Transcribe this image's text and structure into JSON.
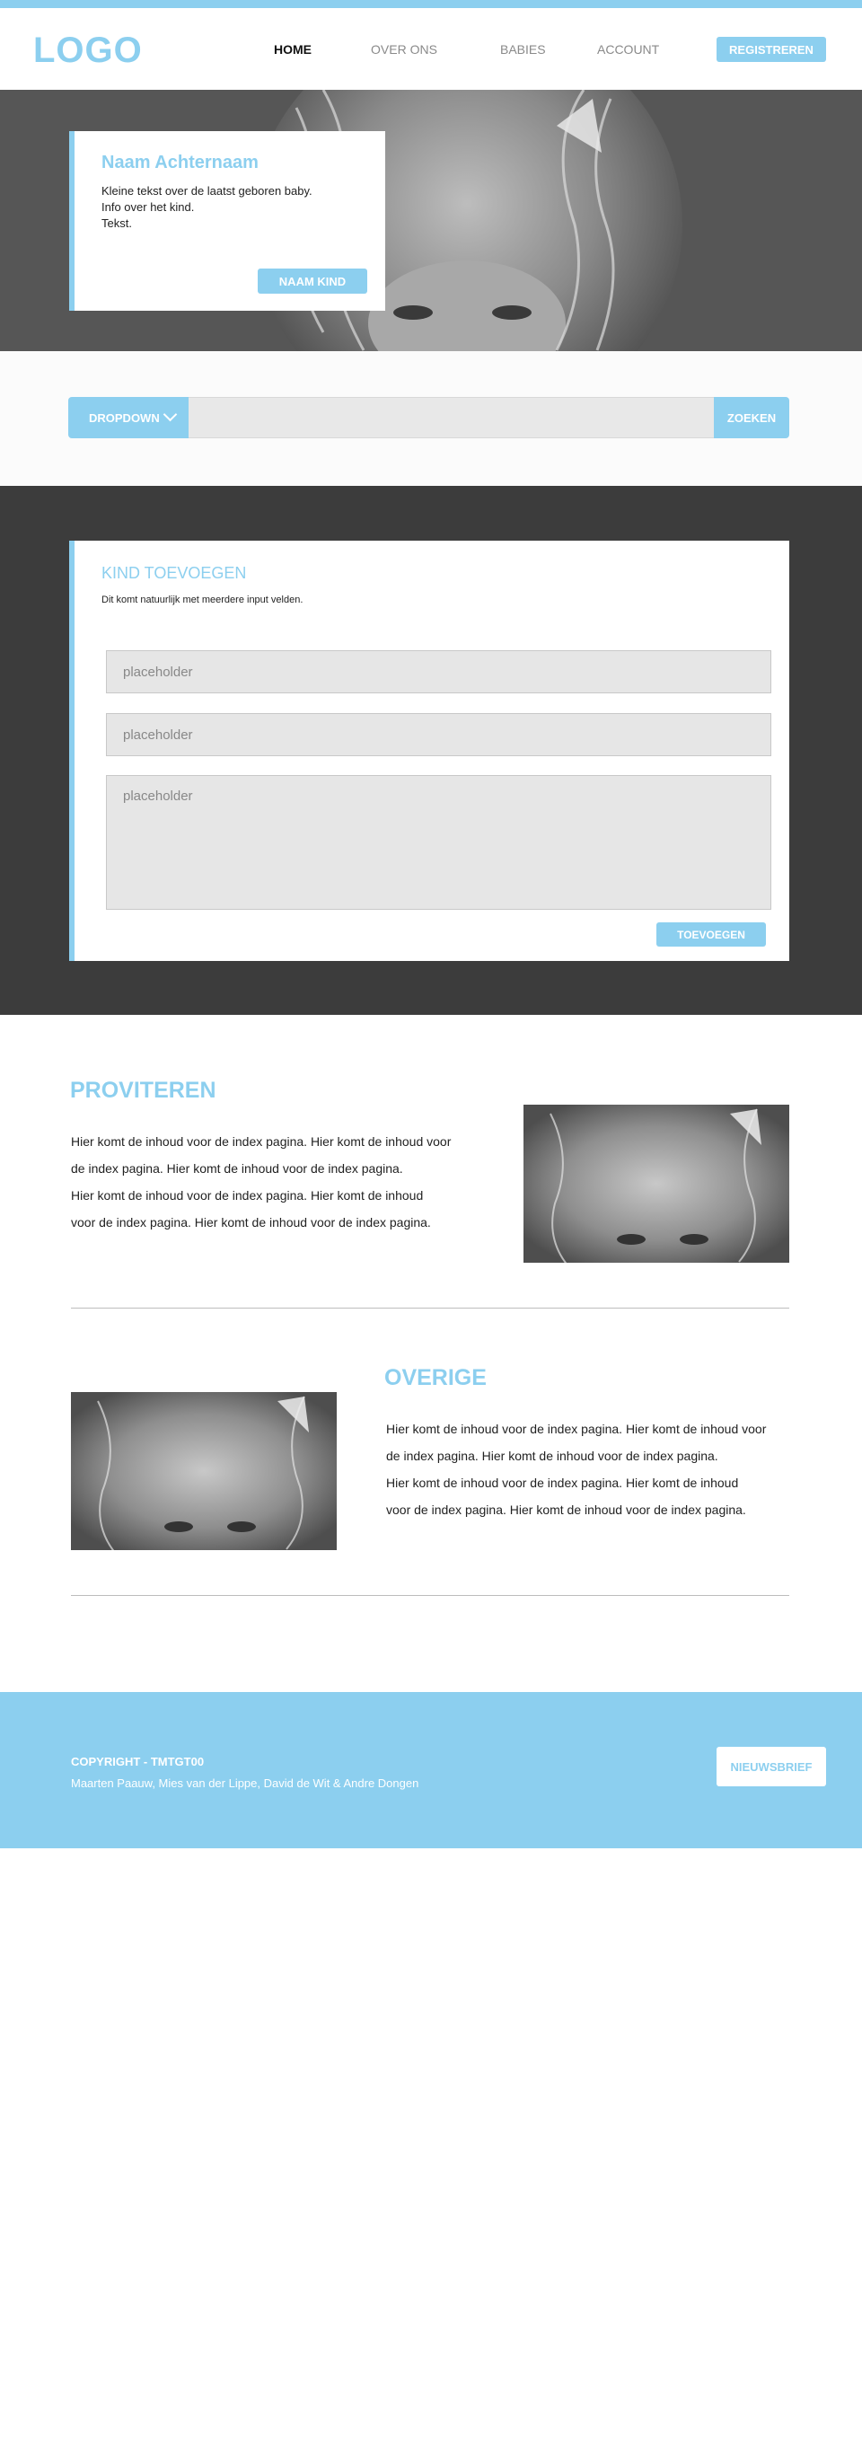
{
  "header": {
    "logo": "LOGO",
    "nav": [
      "HOME",
      "OVER ONS",
      "BABIES",
      "ACCOUNT"
    ],
    "active_nav": "HOME",
    "register_label": "REGISTREREN"
  },
  "hero": {
    "name": "Naam Achternaam",
    "text_lines": [
      "Kleine tekst over de laatst geboren baby.",
      "Info over het kind.",
      "Tekst."
    ],
    "button_label": "NAAM KIND"
  },
  "search": {
    "dropdown_label": "DROPDOWN",
    "input_value": "",
    "button_label": "ZOEKEN"
  },
  "add_child": {
    "title": "KIND TOEVOEGEN",
    "subtitle": "Dit komt natuurlijk met meerdere input velden.",
    "fields": [
      {
        "placeholder": "placeholder"
      },
      {
        "placeholder": "placeholder"
      },
      {
        "placeholder": "placeholder"
      }
    ],
    "button_label": "TOEVOEGEN"
  },
  "sections": [
    {
      "title": "PROVITEREN",
      "lines": [
        "Hier komt de inhoud voor de index pagina. Hier komt de inhoud voor",
        "de index pagina. Hier komt de inhoud voor de index pagina.",
        "Hier komt de inhoud voor de index pagina. Hier komt de inhoud",
        "voor de index pagina. Hier komt de inhoud voor de index pagina."
      ]
    },
    {
      "title": "OVERIGE",
      "lines": [
        "Hier komt de inhoud voor de index pagina. Hier komt de inhoud voor",
        "de index pagina. Hier komt de inhoud voor de index pagina.",
        "Hier komt de inhoud voor de index pagina. Hier komt de inhoud",
        "voor de index pagina. Hier komt de inhoud voor de index pagina."
      ]
    }
  ],
  "footer": {
    "copyright": "COPYRIGHT - TMTGT00",
    "credits": "Maarten Paauw, Mies van der Lippe, David de Wit & Andre Dongen",
    "newsletter_label": "NIEUWSBRIEF"
  },
  "colors": {
    "accent": "#8ccfef",
    "dark_band": "#3c3c3c"
  }
}
